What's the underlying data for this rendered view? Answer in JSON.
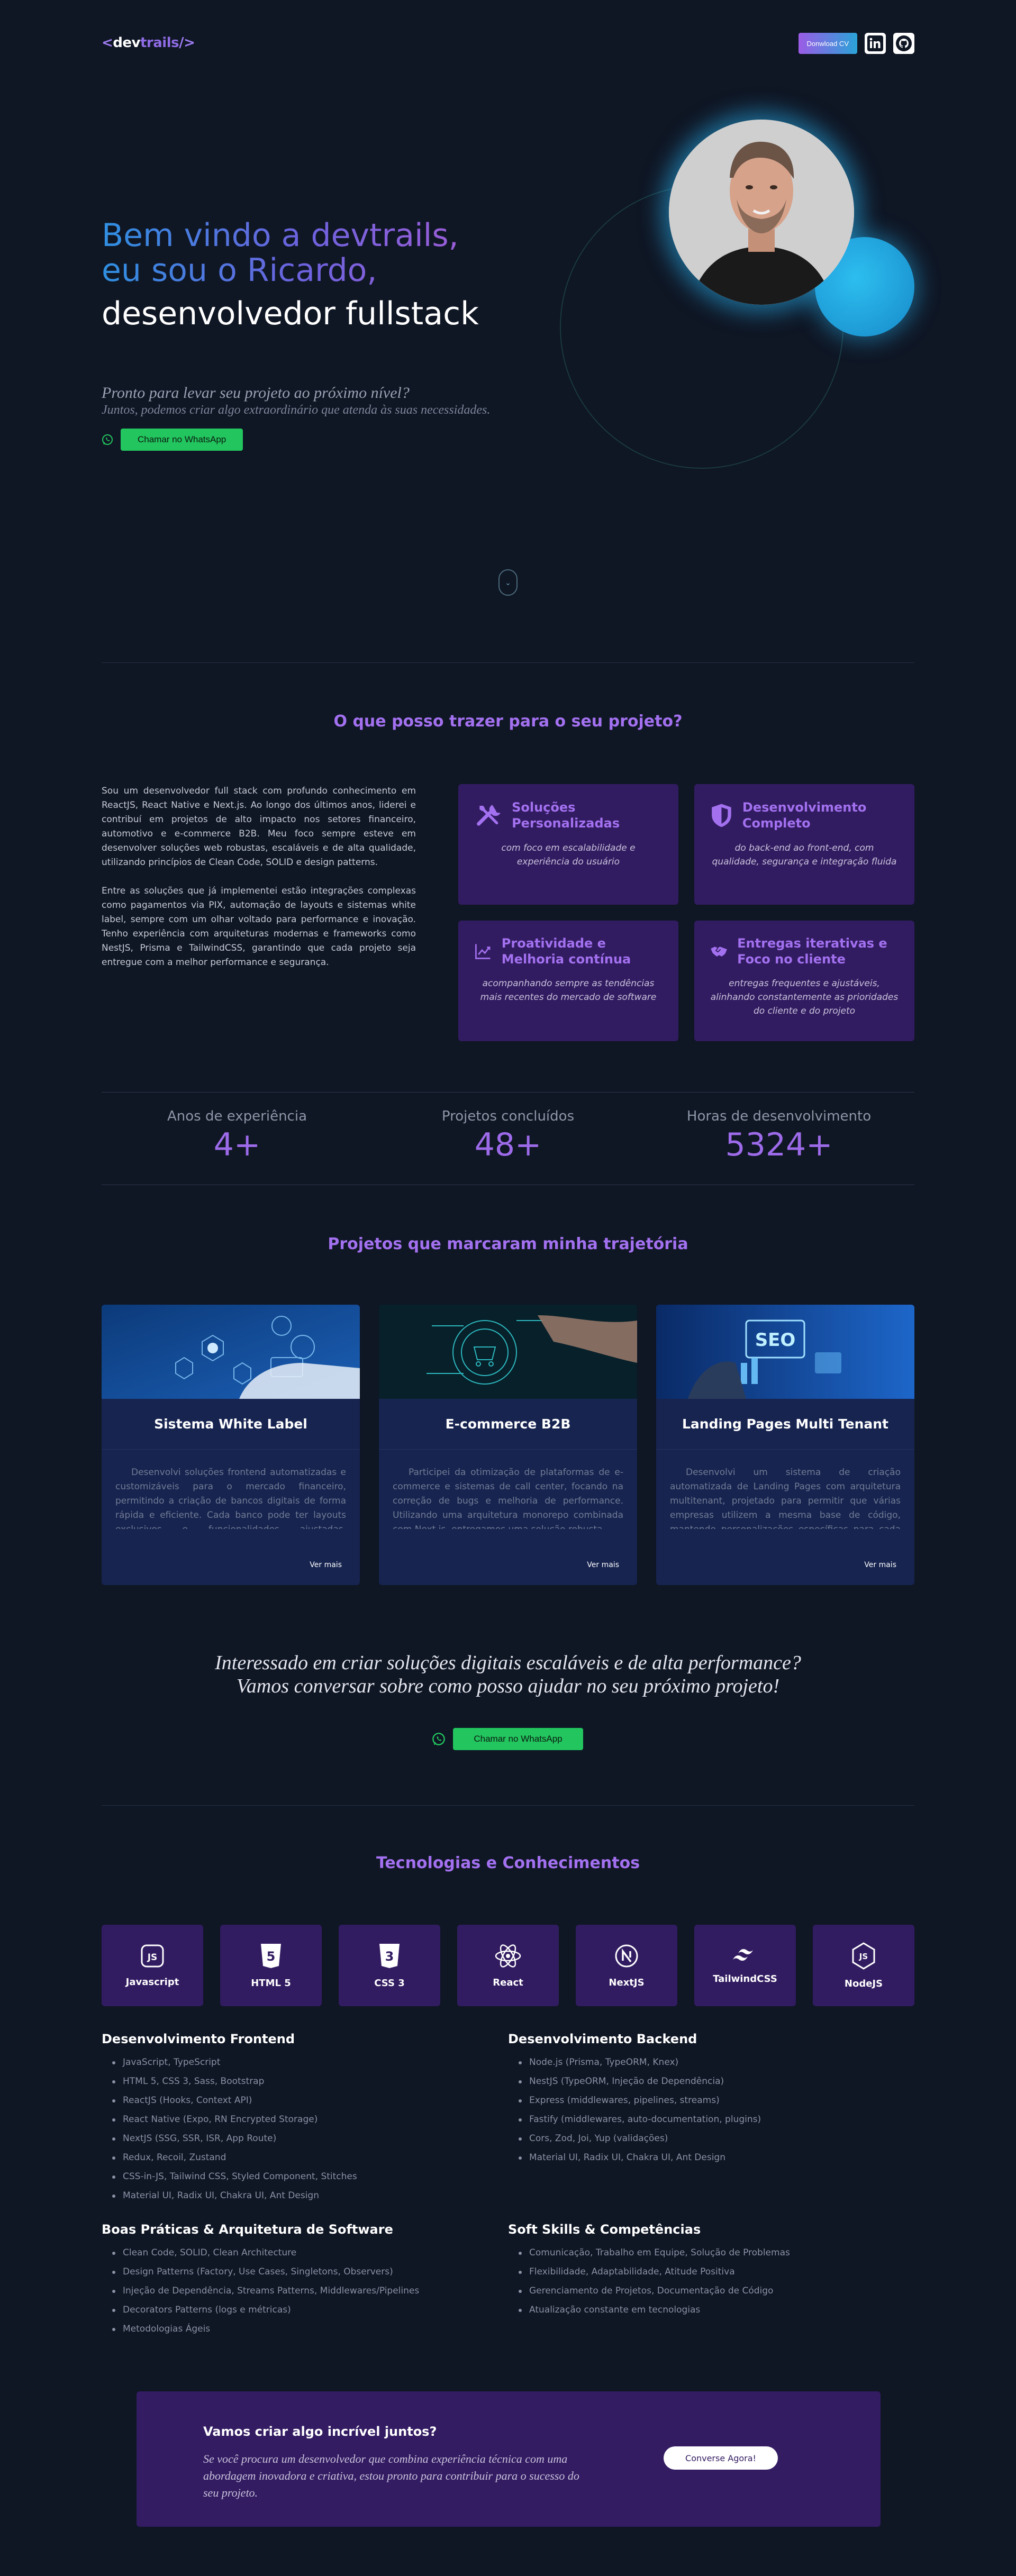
{
  "header": {
    "logo": {
      "open": "<",
      "dev": "dev",
      "trails": "trails",
      "close": "/>"
    },
    "download_cv": "Donwload CV"
  },
  "hero": {
    "title_line1": "Bem vindo a devtrails,",
    "title_line2": "eu sou o Ricardo,",
    "title_line3": "desenvolvedor fullstack",
    "question": "Pronto para levar seu projeto ao próximo nível?",
    "subtitle": "Juntos, podemos criar algo extraordinário que atenda às suas necessidades.",
    "whatsapp_button": "Chamar no WhatsApp"
  },
  "about": {
    "title": "O que posso trazer para o seu projeto?",
    "paragraph1": "Sou um desenvolvedor full stack com profundo conhecimento em ReactJS, React Native e Next.js. Ao longo dos últimos anos, liderei e contribuí em projetos de alto impacto nos setores financeiro, automotivo e e-commerce B2B. Meu foco sempre esteve em desenvolver soluções web robustas, escaláveis e de alta qualidade, utilizando princípios de Clean Code, SOLID e design patterns.",
    "paragraph2": "Entre as soluções que já implementei estão integrações complexas como pagamentos via PIX, automação de layouts e sistemas white label, sempre com um olhar voltado para performance e inovação. Tenho experiência com arquiteturas modernas e frameworks como NestJS, Prisma e TailwindCSS, garantindo que cada projeto seja entregue com a melhor performance e segurança.",
    "features": [
      {
        "title": "Soluções Personalizadas",
        "desc": "com foco em escalabilidade e experiência do usuário",
        "icon": "tools-icon"
      },
      {
        "title": "Desenvolvimento Completo",
        "desc": "do back-end ao front-end, com qualidade, segurança e integração fluida",
        "icon": "shield-icon"
      },
      {
        "title": "Proatividade e Melhoria contínua",
        "desc": "acompanhando sempre as tendências mais recentes do mercado de software",
        "icon": "trend-icon"
      },
      {
        "title": "Entregas iterativas e Foco no cliente",
        "desc": "entregas frequentes e ajustáveis, alinhando constantemente as prioridades do cliente e do projeto",
        "icon": "handshake-icon"
      }
    ]
  },
  "stats": [
    {
      "label": "Anos de experiência",
      "value": "4+"
    },
    {
      "label": "Projetos concluídos",
      "value": "48+"
    },
    {
      "label": "Horas de desenvolvimento",
      "value": "5324+"
    }
  ],
  "projects": {
    "title": "Projetos que marcaram minha trajetória",
    "more_label": "Ver mais",
    "items": [
      {
        "title": "Sistema White Label",
        "desc": "Desenvolvi soluções frontend automatizadas e customizáveis para o mercado financeiro, permitindo a criação de bancos digitais de forma rápida e eficiente. Cada banco pode ter layouts exclusivos e funcionalidades ajustadas, oferecendo uma experiência única."
      },
      {
        "title": "E-commerce B2B",
        "desc": "Participei da otimização de plataformas de e-commerce e sistemas de call center, focando na correção de bugs e melhoria de performance. Utilizando uma arquitetura monorepo combinada com Next.js, entregamos uma solução robusta."
      },
      {
        "title": "Landing Pages Multi Tenant",
        "desc": "Desenvolvi um sistema de criação automatizada de Landing Pages com arquitetura multitenant, projetado para permitir que várias empresas utilizem a mesma base de código, mantendo personalizações específicas para cada cliente."
      }
    ]
  },
  "cta": {
    "line1": "Interessado em criar soluções digitais escaláveis e de alta performance?",
    "line2": "Vamos conversar sobre como posso ajudar no seu próximo projeto!",
    "whatsapp_button": "Chamar no WhatsApp"
  },
  "tech": {
    "title": "Tecnologias e Conhecimentos",
    "items": [
      {
        "name": "Javascript",
        "icon": "js-icon"
      },
      {
        "name": "HTML 5",
        "icon": "html5-icon"
      },
      {
        "name": "CSS 3",
        "icon": "css3-icon"
      },
      {
        "name": "React",
        "icon": "react-icon"
      },
      {
        "name": "NextJS",
        "icon": "nextjs-icon"
      },
      {
        "name": "TailwindCSS",
        "icon": "tailwind-icon"
      },
      {
        "name": "NodeJS",
        "icon": "nodejs-icon"
      }
    ]
  },
  "skills": {
    "frontend": {
      "title": "Desenvolvimento Frontend",
      "items": [
        "JavaScript, TypeScript",
        "HTML 5, CSS 3, Sass, Bootstrap",
        "ReactJS (Hooks, Context API)",
        "React Native (Expo, RN Encrypted Storage)",
        "NextJS (SSG, SSR, ISR, App Route)",
        "Redux, Recoil, Zustand",
        "CSS-in-JS, Tailwind CSS, Styled Component, Stitches",
        "Material UI, Radix UI, Chakra UI, Ant Design"
      ]
    },
    "backend": {
      "title": "Desenvolvimento Backend",
      "items": [
        "Node.js (Prisma, TypeORM, Knex)",
        "NestJS (TypeORM, Injeção de Dependência)",
        "Express (middlewares, pipelines, streams)",
        "Fastify (middlewares, auto-documentation, plugins)",
        "Cors, Zod, Joi, Yup (validações)",
        "Material UI, Radix UI, Chakra UI, Ant Design"
      ]
    },
    "practices": {
      "title": "Boas Práticas & Arquitetura de Software",
      "items": [
        "Clean Code, SOLID, Clean Architecture",
        "Design Patterns (Factory, Use Cases, Singletons, Observers)",
        "Injeção de Dependência, Streams Patterns, Middlewares/Pipelines",
        "Decorators Patterns (logs e métricas)",
        "Metodologias Ágeis"
      ]
    },
    "soft": {
      "title": "Soft Skills & Competências",
      "items": [
        "Comunicação, Trabalho em Equipe, Solução de Problemas",
        "Flexibilidade, Adaptabilidade, Atitude Positiva",
        "Gerenciamento de Projetos, Documentação de Código",
        "Atualização constante em tecnologias"
      ]
    }
  },
  "final": {
    "title": "Vamos criar algo incrível juntos?",
    "text": "Se você procura um desenvolvedor que combina experiência técnica com uma abordagem inovadora e criativa, estou pronto para contribuir para o sucesso do seu projeto.",
    "button": "Converse Agora!"
  },
  "colors": {
    "accent": "#a371f0",
    "card_bg": "#321c61",
    "page_bg": "#0f1624",
    "whatsapp": "#22c55e",
    "project_bg": "#172450"
  }
}
